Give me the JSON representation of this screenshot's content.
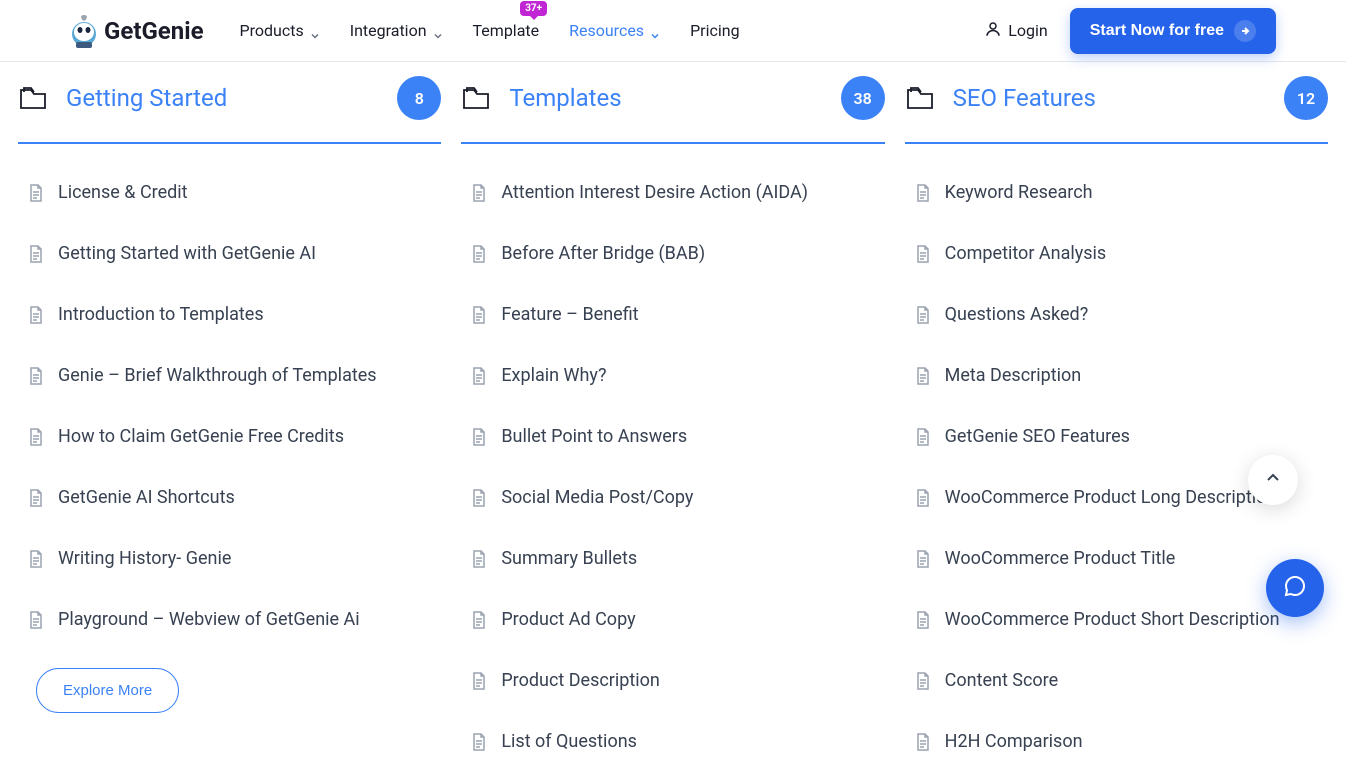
{
  "header": {
    "logo_text": "GetGenie",
    "nav": [
      {
        "label": "Products",
        "has_dropdown": true,
        "active": false,
        "badge": null
      },
      {
        "label": "Integration",
        "has_dropdown": true,
        "active": false,
        "badge": null
      },
      {
        "label": "Template",
        "has_dropdown": false,
        "active": false,
        "badge": "37+"
      },
      {
        "label": "Resources",
        "has_dropdown": true,
        "active": true,
        "badge": null
      },
      {
        "label": "Pricing",
        "has_dropdown": false,
        "active": false,
        "badge": null
      }
    ],
    "login_label": "Login",
    "cta_label": "Start Now for free"
  },
  "cards": [
    {
      "title": "Getting Started",
      "count": "8",
      "items": [
        "License & Credit",
        "Getting Started with GetGenie AI",
        "Introduction to Templates",
        "Genie – Brief Walkthrough of Templates",
        "How to Claim GetGenie Free Credits",
        "GetGenie AI Shortcuts",
        "Writing History- Genie",
        "Playground – Webview of GetGenie Ai"
      ],
      "explore_label": "Explore More"
    },
    {
      "title": "Templates",
      "count": "38",
      "items": [
        "Attention Interest Desire Action (AIDA)",
        "Before After Bridge (BAB)",
        "Feature – Benefit",
        "Explain Why?",
        "Bullet Point to Answers",
        "Social Media Post/Copy",
        "Summary Bullets",
        "Product Ad Copy",
        "Product Description",
        "List of Questions"
      ]
    },
    {
      "title": "SEO Features",
      "count": "12",
      "items": [
        "Keyword Research",
        "Competitor Analysis",
        "Questions Asked?",
        "Meta Description",
        "GetGenie SEO Features",
        "WooCommerce Product Long Description",
        "WooCommerce Product Title",
        "WooCommerce Product Short Description",
        "Content Score",
        "H2H Comparison"
      ]
    }
  ]
}
